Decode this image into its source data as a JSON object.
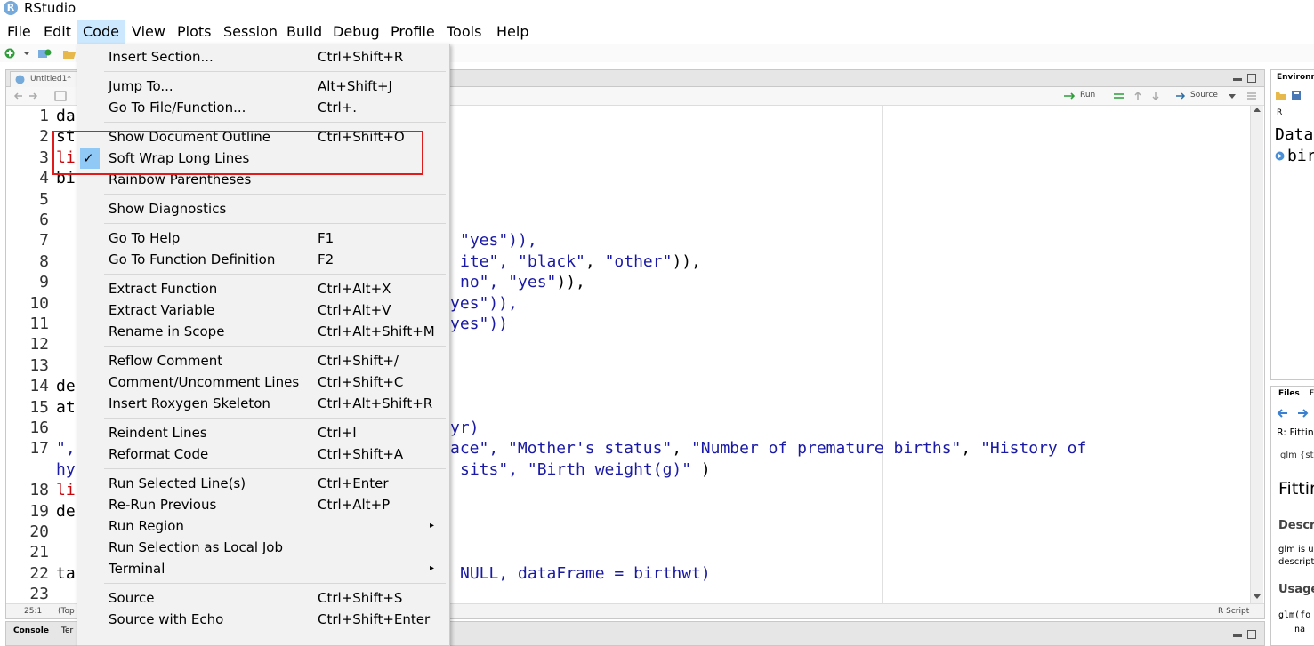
{
  "window": {
    "title": "RStudio",
    "icon_letter": "R"
  },
  "menubar": [
    "File",
    "Edit",
    "Code",
    "View",
    "Plots",
    "Session",
    "Build",
    "Debug",
    "Profile",
    "Tools",
    "Help"
  ],
  "editor": {
    "tab_label": "Untitled1*",
    "toolbar": {
      "run": "Run",
      "source": "Source"
    },
    "line_numbers": [
      "1",
      "2",
      "3",
      "4",
      "5",
      "6",
      "7",
      "8",
      "9",
      "10",
      "11",
      "12",
      "13",
      "14",
      "15",
      "16",
      "17",
      "",
      "18",
      "19",
      "20",
      "21",
      "22",
      "23"
    ],
    "code_fragments": [
      {
        "text": "da"
      },
      {
        "text": "st"
      },
      {
        "text": "li"
      },
      {
        "text": "bi"
      },
      {
        "text": "de"
      },
      {
        "text": "at"
      },
      {
        "text": "\","
      },
      {
        "text": "hy"
      },
      {
        "text": "li"
      },
      {
        "text": "de"
      },
      {
        "text": "ta"
      }
    ],
    "code_visible": {
      "l7": "\"yes\")),",
      "l8a": "ite\", ",
      "l8b": "\"black\"",
      "l8c": ", ",
      "l8d": "\"other\"",
      "l8e": ")),",
      "l9a": "no\", ",
      "l9b": "\"yes\"",
      "l9c": ")),",
      "l10": "yes\")),",
      "l11": "yes\"))",
      "l16": "yr)",
      "l17a": "ace\", ",
      "l17b": "\"Mother's status\"",
      "l17c": ", ",
      "l17d": "\"Number of premature births\"",
      "l17e": ", ",
      "l17f": "\"History of",
      "l17g": "sits\", ",
      "l17h": "\"Birth weight(g)\"",
      "l17i": " )",
      "l22": "NULL, dataFrame = birthwt)"
    },
    "status": {
      "position": "25:1",
      "scope": "(Top",
      "filetype": "R Script"
    }
  },
  "console_tabs": [
    "Console",
    "Ter"
  ],
  "right_top": {
    "tab": "Environm",
    "r_label": "R",
    "data_label": "Data",
    "item": "bir"
  },
  "right_bottom": {
    "tabs": [
      "Files",
      "F"
    ],
    "title": "R: Fittin",
    "pkg": "glm {sta",
    "heading": "Fittir",
    "section1": "Descri",
    "desc_a": "glm is u",
    "desc_b": "descript",
    "section2": "Usage",
    "usage_a": "glm(fo",
    "usage_b": "na"
  },
  "code_menu": {
    "items": [
      {
        "label": "Insert Section...",
        "shortcut": "Ctrl+Shift+R"
      },
      {
        "label": "Jump To...",
        "shortcut": "Alt+Shift+J"
      },
      {
        "label": "Go To File/Function...",
        "shortcut": "Ctrl+."
      },
      {
        "label": "Show Document Outline",
        "shortcut": "Ctrl+Shift+O"
      },
      {
        "label": "Soft Wrap Long Lines",
        "shortcut": "",
        "checked": true
      },
      {
        "label": "Rainbow Parentheses",
        "shortcut": ""
      },
      {
        "label": "Show Diagnostics",
        "shortcut": ""
      },
      {
        "label": "Go To Help",
        "shortcut": "F1"
      },
      {
        "label": "Go To Function Definition",
        "shortcut": "F2"
      },
      {
        "label": "Extract Function",
        "shortcut": "Ctrl+Alt+X"
      },
      {
        "label": "Extract Variable",
        "shortcut": "Ctrl+Alt+V"
      },
      {
        "label": "Rename in Scope",
        "shortcut": "Ctrl+Alt+Shift+M"
      },
      {
        "label": "Reflow Comment",
        "shortcut": "Ctrl+Shift+/"
      },
      {
        "label": "Comment/Uncomment Lines",
        "shortcut": "Ctrl+Shift+C"
      },
      {
        "label": "Insert Roxygen Skeleton",
        "shortcut": "Ctrl+Alt+Shift+R"
      },
      {
        "label": "Reindent Lines",
        "shortcut": "Ctrl+I"
      },
      {
        "label": "Reformat Code",
        "shortcut": "Ctrl+Shift+A"
      },
      {
        "label": "Run Selected Line(s)",
        "shortcut": "Ctrl+Enter"
      },
      {
        "label": "Re-Run Previous",
        "shortcut": "Ctrl+Alt+P"
      },
      {
        "label": "Run Region",
        "shortcut": "",
        "submenu": true
      },
      {
        "label": "Run Selection as Local Job",
        "shortcut": ""
      },
      {
        "label": "Terminal",
        "shortcut": "",
        "submenu": true
      },
      {
        "label": "Source",
        "shortcut": "Ctrl+Shift+S"
      },
      {
        "label": "Source with Echo",
        "shortcut": "Ctrl+Shift+Enter"
      }
    ],
    "submenu_arrow": "▸",
    "check_glyph": "✓"
  },
  "colors": {
    "highlight_border": "#e01b1b",
    "menu_bg": "#f2f2f2",
    "check_bg": "#90c8f6",
    "string": "#036a07",
    "keyword": "#c5060b",
    "identifier": "#1a1aa6"
  }
}
